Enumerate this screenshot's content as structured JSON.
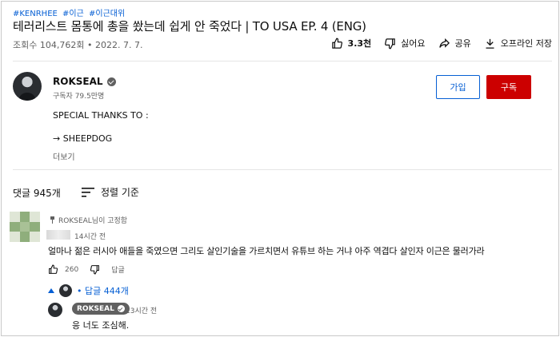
{
  "video": {
    "hashtags": [
      "#KENRHEE",
      "#이근",
      "#이근대위"
    ],
    "title": "테러리스트 몸통에 총을 쐈는데 쉽게 안 죽었다 | TO USA EP. 4 (ENG)",
    "views": "조회수 104,762회",
    "date": "2022. 7. 7."
  },
  "actions": {
    "like_count": "3.3천",
    "dislike_label": "싫어요",
    "share_label": "공유",
    "offline_label": "오프라인 저장"
  },
  "channel": {
    "name": "ROKSEAL",
    "subscribers": "구독자 79.5만명",
    "join_label": "가입",
    "subscribe_label": "구독"
  },
  "description": {
    "line1": "SPECIAL THANKS TO :",
    "line2": "→ SHEEPDOG",
    "more_label": "더보기"
  },
  "comments_header": {
    "count_label": "댓글 945개",
    "sort_label": "정렬 기준"
  },
  "comment": {
    "pinned_label": "ROKSEAL님이 고정함",
    "time": "14시간 전",
    "text": "얼마나 젊은 러시아 애들을 죽였으면 그리도 살인기술을 가르치면서 유튜브 하는 거냐 아주 역겹다 살인자 이근은 물러가라",
    "like_count": "260",
    "reply_label": "답글",
    "replies_toggle": "• 답글 444개"
  },
  "reply": {
    "author": "ROKSEAL",
    "time": "13시간 전",
    "text": "응 너도 조심해."
  },
  "colors": {
    "link_blue": "#065fd4",
    "subscribe_red": "#cc0000",
    "secondary_text": "#606060"
  }
}
